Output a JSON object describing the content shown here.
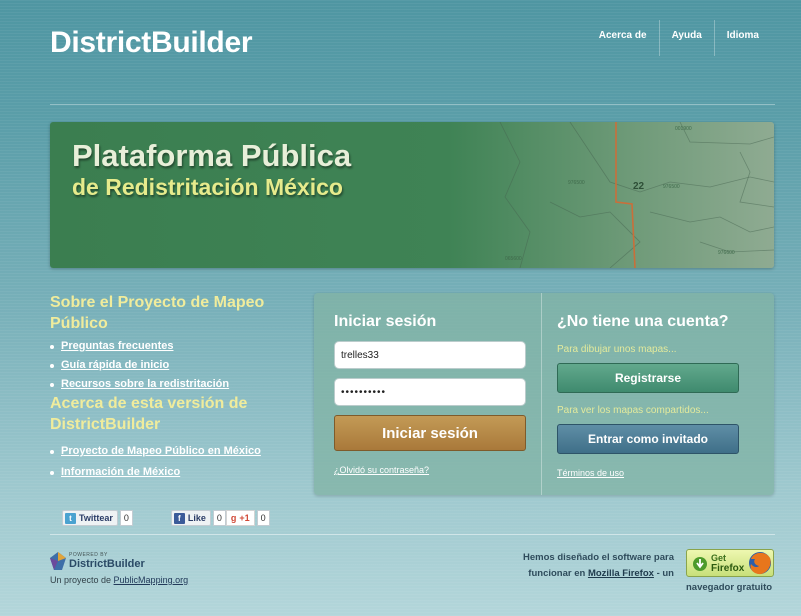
{
  "header": {
    "logo": "DistrictBuilder",
    "nav": [
      "Acerca de",
      "Ayuda",
      "Idioma"
    ]
  },
  "banner": {
    "line1": "Plataforma Pública",
    "line2": "de Redistritación México",
    "map_labels": [
      "001900",
      "976500",
      "976600",
      "22",
      "065600",
      "976500"
    ]
  },
  "sidebar": {
    "section1_title": "Sobre el Proyecto de Mapeo Público",
    "section1_links": [
      "Preguntas frecuentes",
      "Guía rápida de inicio",
      "Recursos sobre la redistritación"
    ],
    "section2_title": "Acerca de esta versión de DistrictBuilder",
    "section2_links": [
      "Proyecto de Mapeo Público en México",
      "Información de México"
    ]
  },
  "social": {
    "tweet_label": "Twittear",
    "tweet_count": "0",
    "like_label": "Like",
    "like_count": "0",
    "plusone_label": "+1",
    "plusone_count": "0"
  },
  "login": {
    "title": "Iniciar sesión",
    "username_value": "trelles33",
    "password_value": "••••••••••",
    "submit_label": "Iniciar sesión",
    "forgot_label": "¿Olvidó su contraseña?"
  },
  "register": {
    "title": "¿No tiene una cuenta?",
    "subtitle1": "Para dibujar unos mapas...",
    "register_label": "Registrarse",
    "subtitle2": "Para ver los mapas compartidos...",
    "guest_label": "Entrar como invitado",
    "terms_label": "Términos de uso"
  },
  "footer": {
    "powered_by": "POWERED BY",
    "powered_name": "DistrictBuilder",
    "credit_prefix": "Un proyecto de ",
    "credit_link": "PublicMapping.org",
    "ff_line1": "Hemos diseñado el software para",
    "ff_line2_prefix": "funcionar en ",
    "ff_link": "Mozilla Firefox",
    "ff_line2_suffix": " - un",
    "ff_badge_get": "Get",
    "ff_badge_name": "Firefox",
    "ff_line3": "navegador gratuito"
  }
}
